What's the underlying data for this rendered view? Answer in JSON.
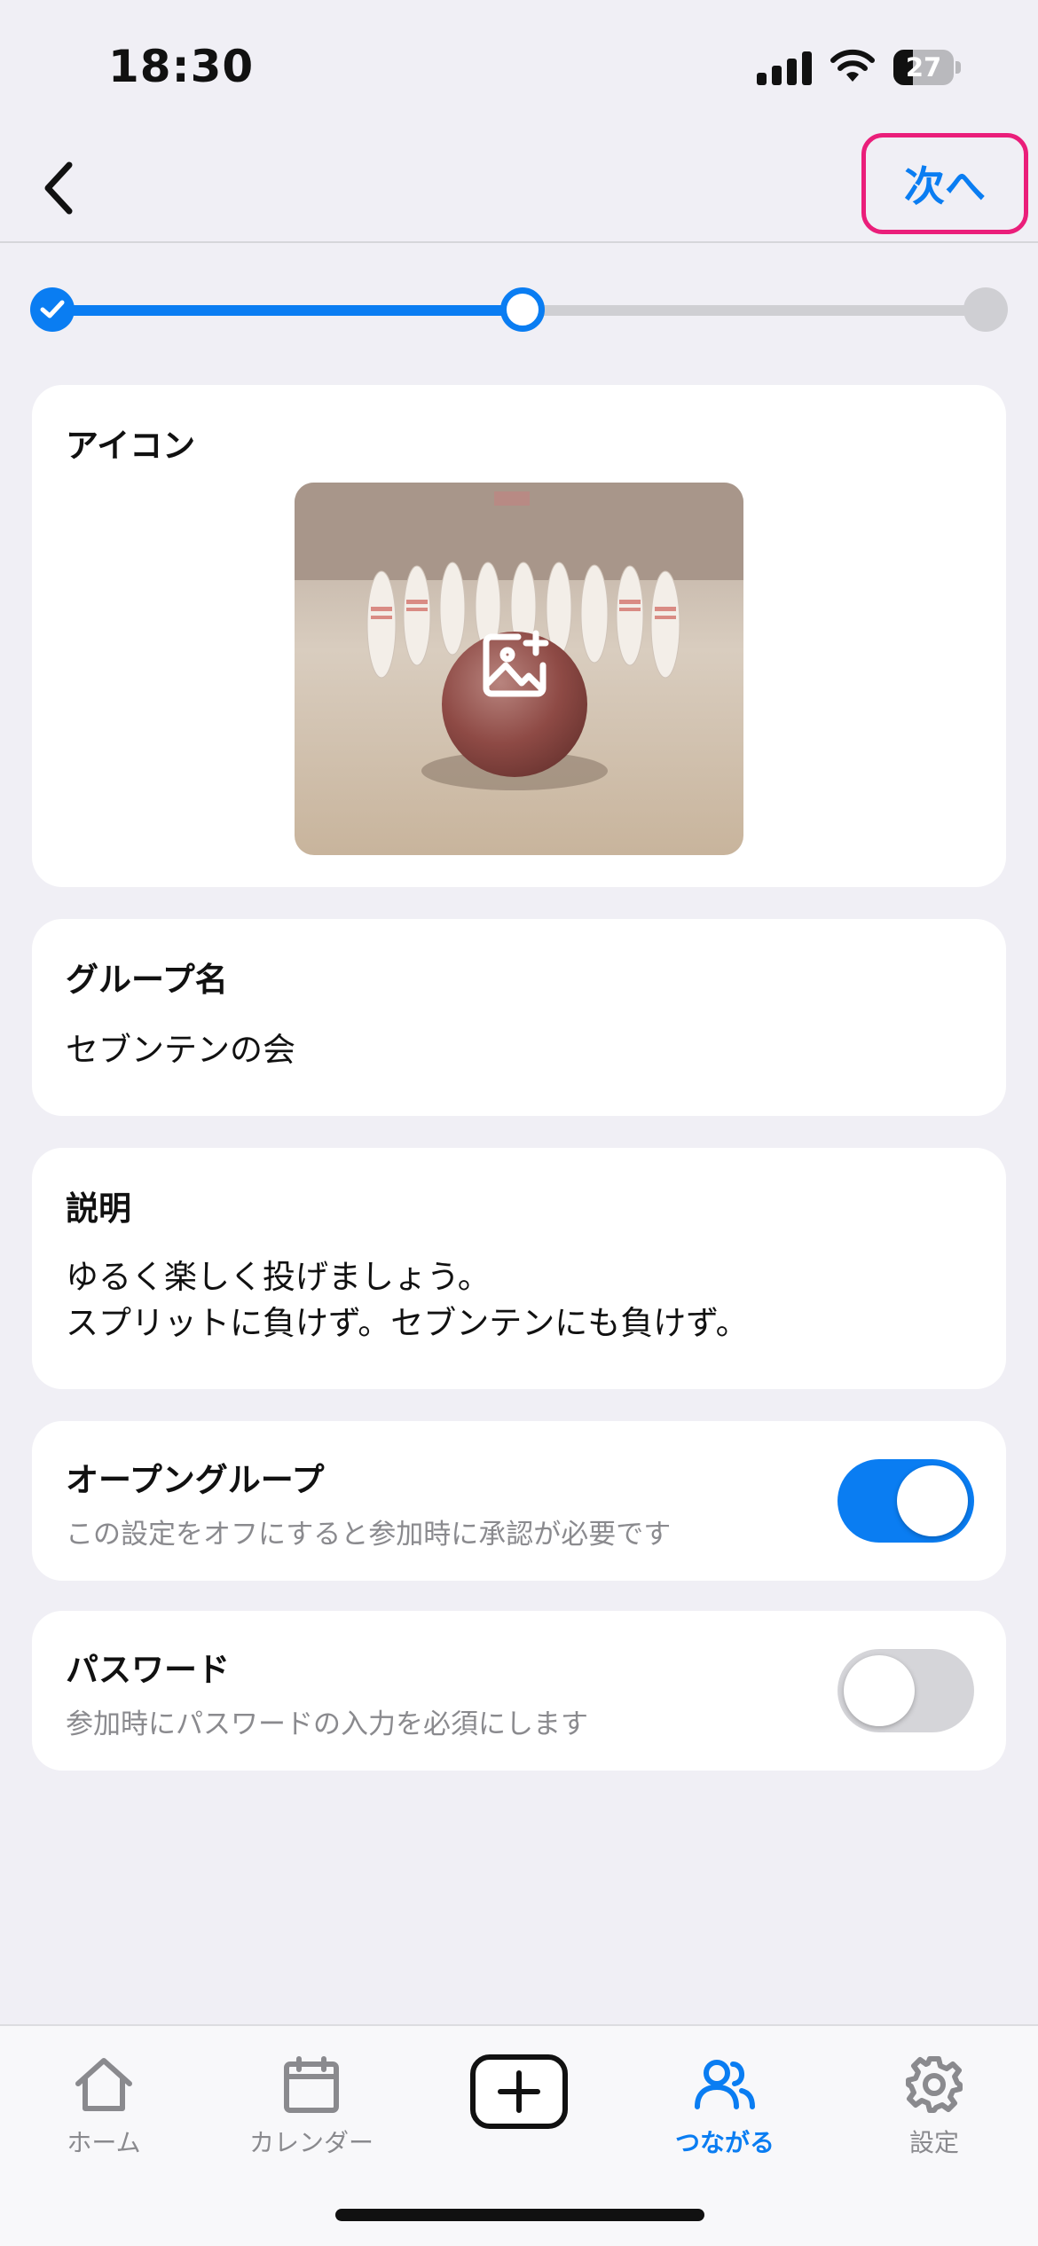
{
  "status_bar": {
    "time": "18:30",
    "battery": "27"
  },
  "nav": {
    "next_label": "次へ"
  },
  "progress": {
    "current_step": 2,
    "total_steps": 3
  },
  "icon_card": {
    "title": "アイコン"
  },
  "group_name_card": {
    "title": "グループ名",
    "value": "セブンテンの会"
  },
  "description_card": {
    "title": "説明",
    "value": "ゆるく楽しく投げましょう。\nスプリットに負けず。セブンテンにも負けず。"
  },
  "open_group_card": {
    "title": "オープングループ",
    "subtitle": "この設定をオフにすると参加時に承認が必要です",
    "enabled": true
  },
  "password_card": {
    "title": "パスワード",
    "subtitle": "参加時にパスワードの入力を必須にします",
    "enabled": false
  },
  "tab_bar": {
    "items": [
      {
        "label": "ホーム",
        "icon": "house-icon",
        "active": false
      },
      {
        "label": "カレンダー",
        "icon": "calendar-icon",
        "active": false
      },
      {
        "label": "",
        "icon": "plus-icon",
        "active": false
      },
      {
        "label": "つながる",
        "icon": "people-icon",
        "active": true
      },
      {
        "label": "設定",
        "icon": "gear-icon",
        "active": false
      }
    ]
  },
  "colors": {
    "accent": "#0a7df2",
    "highlight_border": "#ea1e7a",
    "background": "#f0eff5"
  }
}
